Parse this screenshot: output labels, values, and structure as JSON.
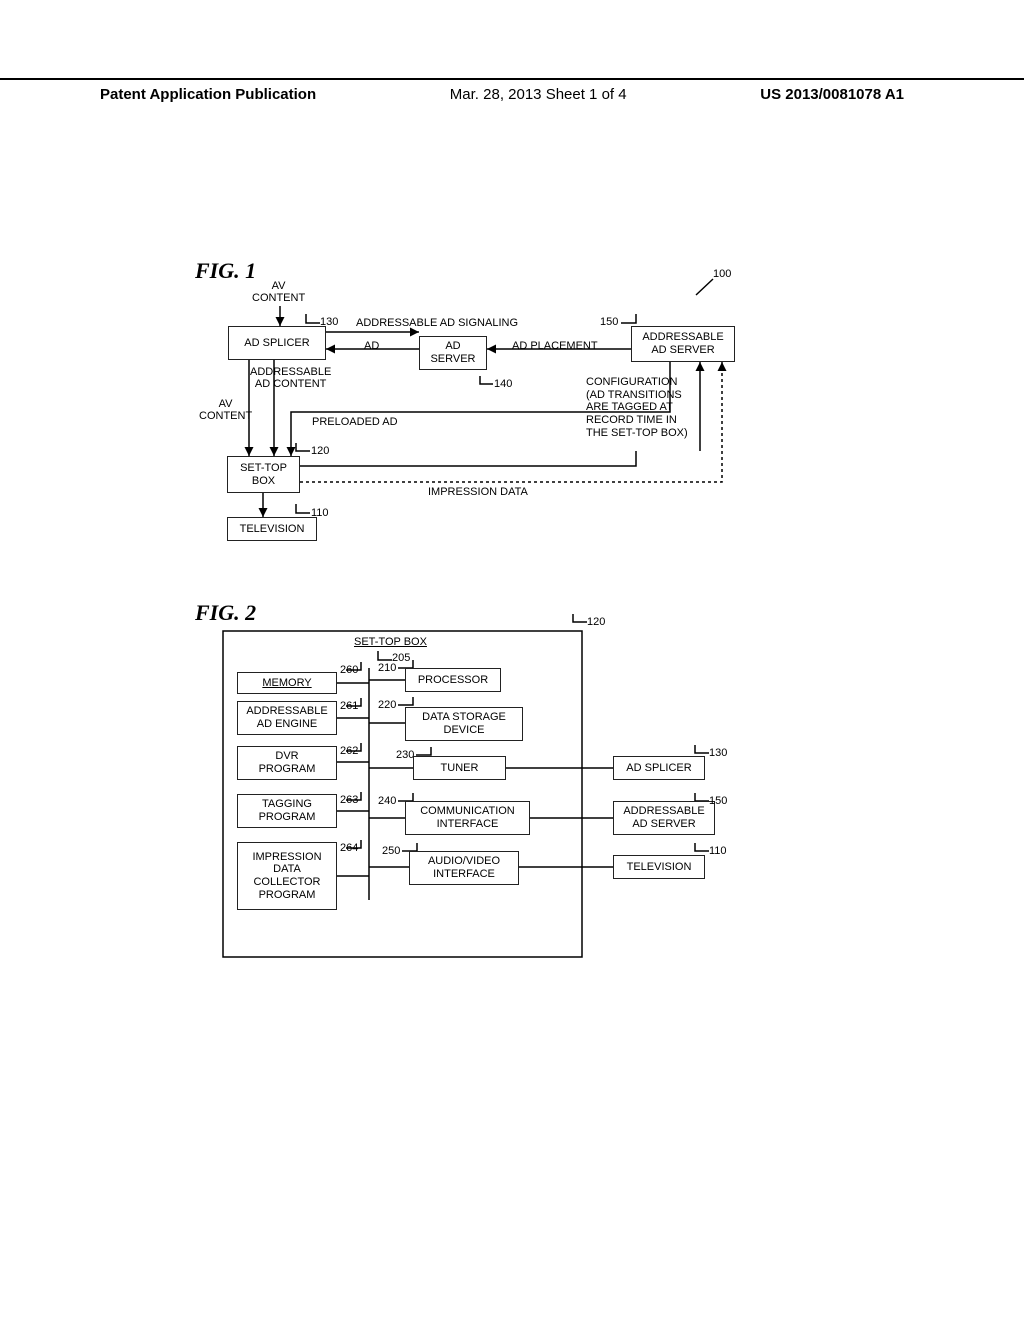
{
  "header": {
    "left": "Patent Application Publication",
    "center": "Mar. 28, 2013  Sheet 1 of 4",
    "right": "US 2013/0081078 A1"
  },
  "fig1": {
    "label": "FIG. 1",
    "boxes": {
      "ad_splicer": "AD SPLICER",
      "ad_server": "AD\nSERVER",
      "addr_ad_server": "ADDRESSABLE\nAD SERVER",
      "stb": "SET-TOP\nBOX",
      "television": "TELEVISION"
    },
    "refs": {
      "r100": "100",
      "r110": "110",
      "r120": "120",
      "r130": "130",
      "r140": "140",
      "r150": "150"
    },
    "labels": {
      "av_content_top": "AV\nCONTENT",
      "addr_signal": "ADDRESSABLE AD SIGNALING",
      "ad": "AD",
      "ad_placement": "AD PLACEMENT",
      "av_content_left": "AV\nCONTENT",
      "addr_ad_content": "ADDRESSABLE\nAD CONTENT",
      "preloaded": "PRELOADED AD",
      "config": "CONFIGURATION\n(AD TRANSITIONS\nARE TAGGED AT\nRECORD TIME IN\nTHE SET-TOP BOX)",
      "impression": "IMPRESSION DATA"
    }
  },
  "fig2": {
    "label": "FIG. 2",
    "title": "SET-TOP BOX",
    "boxes": {
      "memory": "MEMORY",
      "addr_engine": "ADDRESSABLE\nAD ENGINE",
      "dvr": "DVR\nPROGRAM",
      "tagging": "TAGGING\nPROGRAM",
      "impression": "IMPRESSION\nDATA\nCOLLECTOR\nPROGRAM",
      "processor": "PROCESSOR",
      "dsd": "DATA STORAGE\nDEVICE",
      "tuner": "TUNER",
      "comm": "COMMUNICATION\nINTERFACE",
      "avif": "AUDIO/VIDEO\nINTERFACE",
      "ad_splicer": "AD SPLICER",
      "addr_server": "ADDRESSABLE\nAD SERVER",
      "television": "TELEVISION"
    },
    "refs": {
      "r120": "120",
      "r205": "205",
      "r210": "210",
      "r220": "220",
      "r230": "230",
      "r240": "240",
      "r250": "250",
      "r260": "260",
      "r261": "261",
      "r262": "262",
      "r263": "263",
      "r264": "264",
      "r130": "130",
      "r150": "150",
      "r110": "110"
    }
  }
}
